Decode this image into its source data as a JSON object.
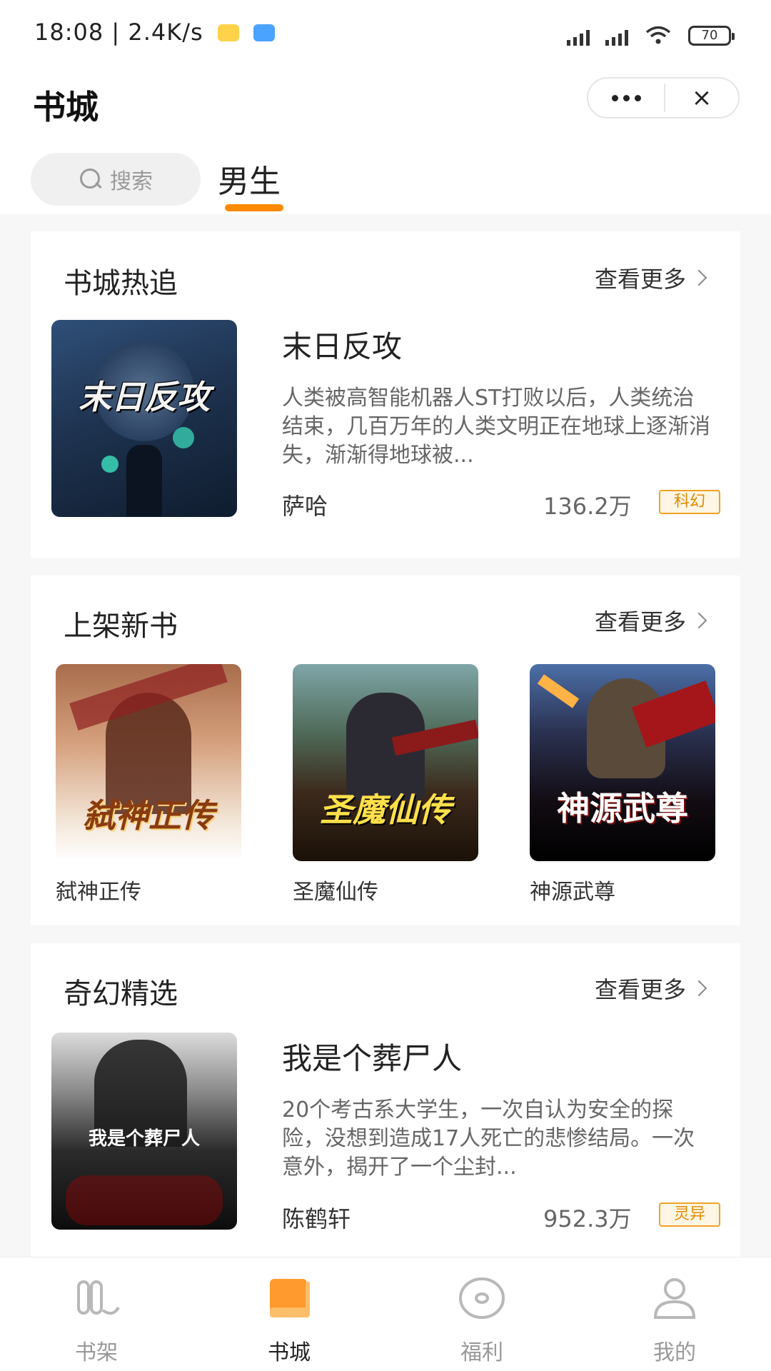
{
  "status": {
    "time": "18:08 | 2.4K/s",
    "battery": "70"
  },
  "header": {
    "title": "书城",
    "more_icon": "more-dots-icon",
    "close": "×"
  },
  "search": {
    "placeholder": "搜索"
  },
  "tabs": [
    {
      "label": "男生",
      "active": true
    }
  ],
  "sections": {
    "hot": {
      "title": "书城热追",
      "more": "查看更多",
      "book": {
        "cover_text": "末日反攻",
        "name": "末日反攻",
        "desc": "人类被高智能机器人ST打败以后，人类统治结束，几百万年的人类文明正在地球上逐渐消失，渐渐得地球被...",
        "author": "萨哈",
        "count": "136.2万",
        "genre": "科幻"
      }
    },
    "new": {
      "title": "上架新书",
      "more": "查看更多",
      "books": [
        {
          "cover_text": "弑神正传",
          "name": "弑神正传"
        },
        {
          "cover_text": "圣魔仙传",
          "name": "圣魔仙传"
        },
        {
          "cover_text": "神源武尊",
          "name": "神源武尊"
        }
      ]
    },
    "fantasy": {
      "title": "奇幻精选",
      "more": "查看更多",
      "book": {
        "cover_text": "我是个葬尸人",
        "name": "我是个葬尸人",
        "desc": "20个考古系大学生，一次自认为安全的探险，没想到造成17人死亡的悲惨结局。一次意外，揭开了一个尘封...",
        "author": "陈鹤轩",
        "count": "952.3万",
        "genre": "灵异"
      }
    }
  },
  "nav": [
    {
      "label": "书架",
      "icon": "bookshelf-icon",
      "active": false
    },
    {
      "label": "书城",
      "icon": "bookstore-icon",
      "active": true
    },
    {
      "label": "福利",
      "icon": "welfare-icon",
      "active": false
    },
    {
      "label": "我的",
      "icon": "profile-icon",
      "active": false
    }
  ],
  "colors": {
    "accent": "#ff8a00",
    "badge_border": "#f0a326"
  }
}
